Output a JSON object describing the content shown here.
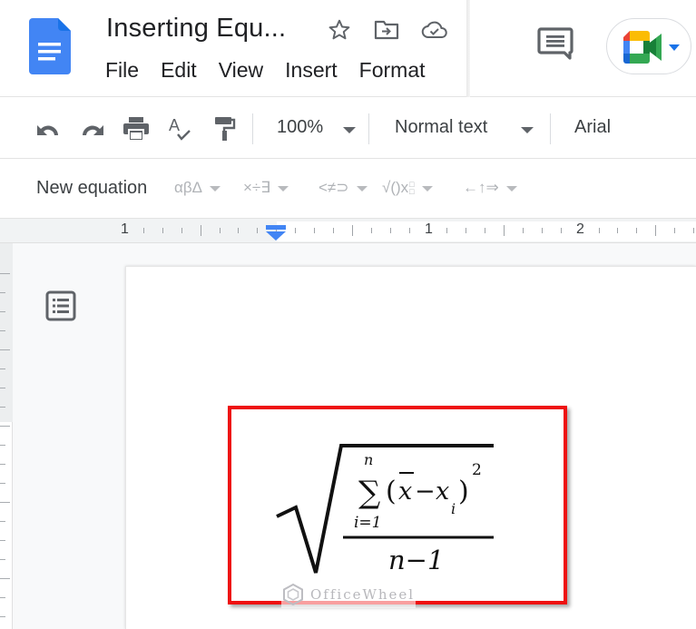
{
  "app": {
    "title": "Inserting Equ...",
    "icons": {
      "logo": "google-docs-logo",
      "star": "star-icon",
      "move": "move-to-folder-icon",
      "cloud": "cloud-saved-icon",
      "comments": "comment-history-icon",
      "meet": "google-meet-icon"
    }
  },
  "menubar": {
    "items": [
      "File",
      "Edit",
      "View",
      "Insert",
      "Format"
    ]
  },
  "toolbar": {
    "icons": [
      "undo-icon",
      "redo-icon",
      "print-icon",
      "spellcheck-icon",
      "paint-format-icon"
    ],
    "zoom": "100%",
    "style": "Normal text",
    "font": "Arial"
  },
  "equation_toolbar": {
    "new_equation": "New equation",
    "groups": [
      {
        "name": "greek-letters",
        "label": "αβΔ"
      },
      {
        "name": "misc-operations",
        "label": "×÷∃"
      },
      {
        "name": "relations",
        "label": "<≠⊃"
      },
      {
        "name": "math-operations",
        "label": "√()x"
      },
      {
        "name": "arrows",
        "label": "←↑⇒"
      }
    ]
  },
  "ruler": {
    "labels": [
      "1",
      "1",
      "2"
    ]
  },
  "document": {
    "equation": {
      "description": "sqrt( sum_{i=1}^{n} (x̄ − x_i)^2 / (n − 1) )",
      "sum_upper": "n",
      "sum_symbol": "∑",
      "sum_lower": "i=1",
      "term_open": "(",
      "x_bar": "x",
      "minus": "−",
      "x_i": "x",
      "sub_i": "i",
      "term_close": ")",
      "exponent": "2",
      "denominator": "n−1"
    },
    "highlight_color": "#ee1111"
  },
  "watermark": {
    "text": "OfficeWheel"
  }
}
